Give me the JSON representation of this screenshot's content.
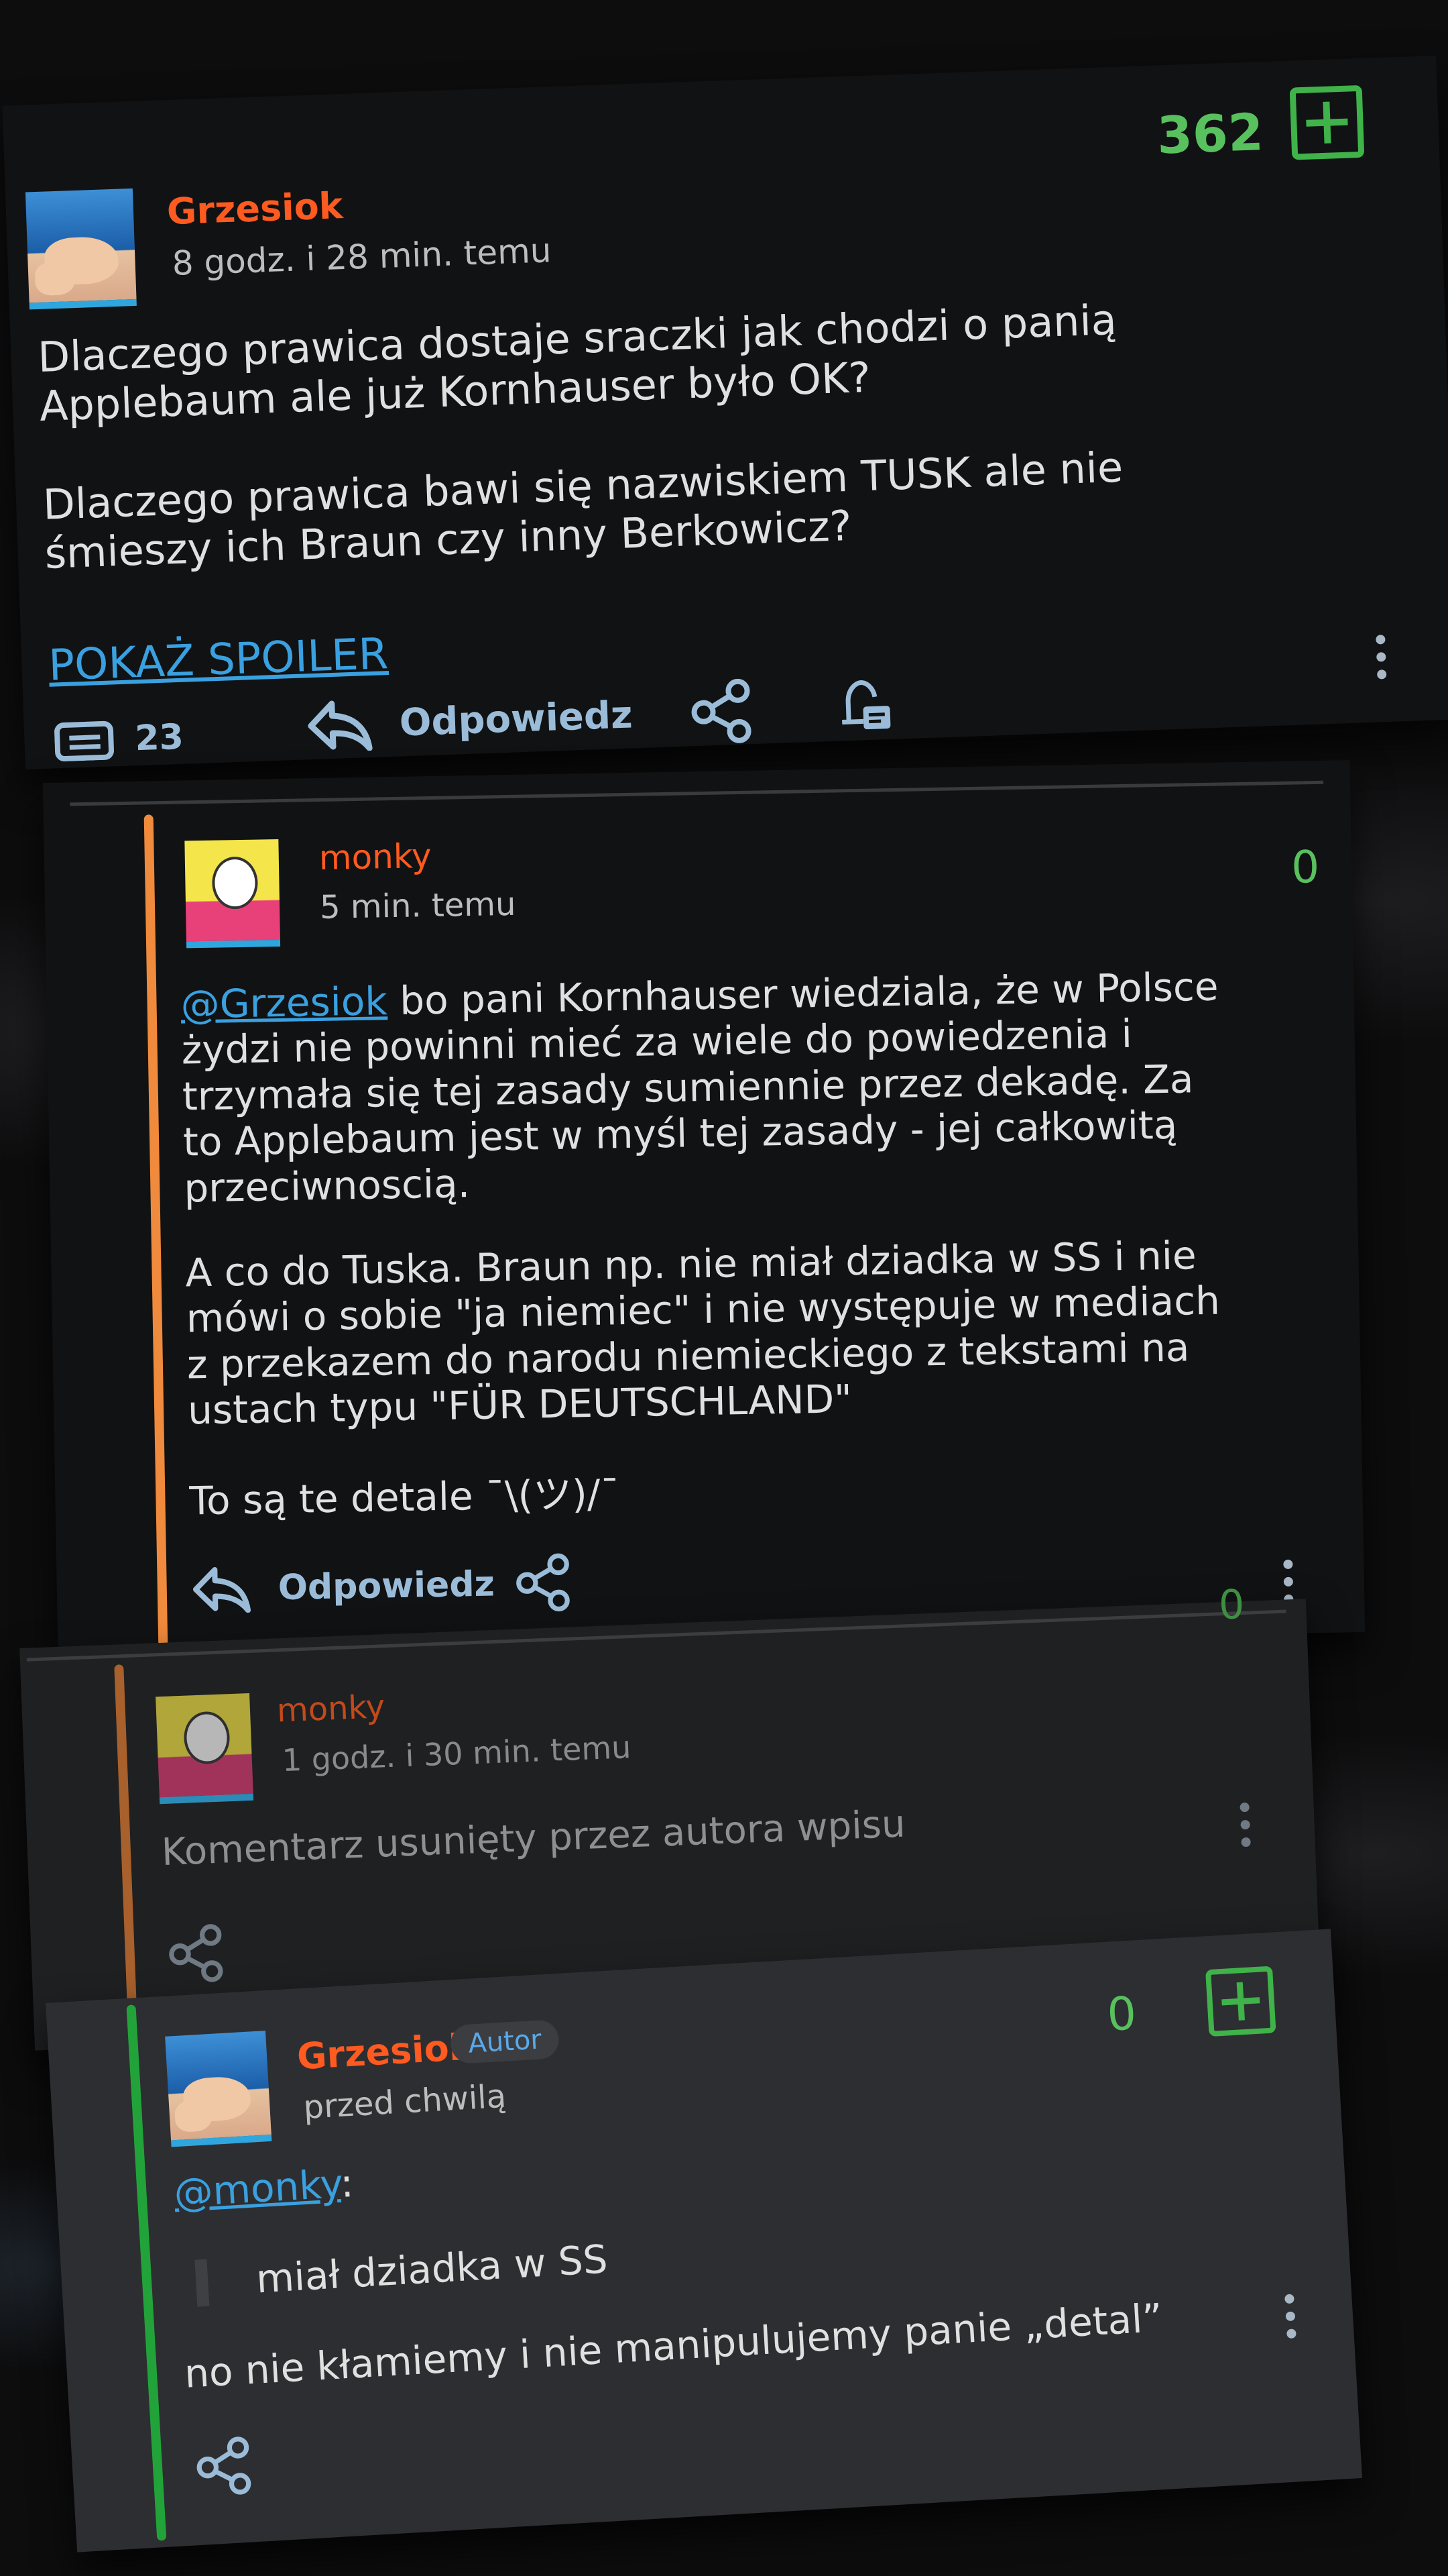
{
  "post": {
    "author": "Grzesiok",
    "time": "8 godz. i 28 min. temu",
    "score": "362",
    "paragraph1": "Dlaczego prawica dostaje sraczki jak chodzi o panią\nApplebaum ale już Kornhauser było OK?",
    "paragraph2": "Dlaczego prawica bawi się nazwiskiem TUSK ale nie\nśmieszy ich Braun czy inny Berkowicz?",
    "spoiler": "POKAŻ SPOILER",
    "comments_count": "23",
    "reply_label": "Odpowiedz"
  },
  "reply1": {
    "author": "monky",
    "time": "5 min. temu",
    "score": "0",
    "mention": "@Grzesiok",
    "text1": " bo pani Kornhauser wiedziala, że w Polsce\nżydzi nie powinni mieć za wiele do powiedzenia i\ntrzymała się tej zasady sumiennie przez dekadę. Za\nto Applebaum jest w myśl tej zasady - jej całkowitą\nprzeciwnoscią.",
    "text2": "A co do Tuska. Braun np. nie miał dziadka w SS i nie\nmówi o sobie \"ja niemiec\" i nie występuje w mediach\nz przekazem do narodu niemieckiego z tekstami na\nustach typu \"FÜR DEUTSCHLAND\"",
    "text3": "To są te detale ¯\\(ツ)/¯",
    "reply_label": "Odpowiedz"
  },
  "reply2": {
    "author": "monky",
    "time": "1 godz. i 30 min. temu",
    "score": "0",
    "text": "Komentarz usunięty przez autora wpisu"
  },
  "reply3": {
    "author": "Grzesiok",
    "badge": "Autor",
    "time": "przed chwilą",
    "score": "0",
    "mention": "@monky",
    "mention_suffix": ":",
    "quote": "miał dziadka w SS",
    "text": "no nie kłamiemy i nie manipulujemy panie „detal”"
  },
  "colors": {
    "username": "#ff5a1f",
    "score_green": "#58c15e",
    "link_blue": "#3aa0e0",
    "thread_orange": "#f08a3c",
    "thread_green": "#22a33a"
  }
}
